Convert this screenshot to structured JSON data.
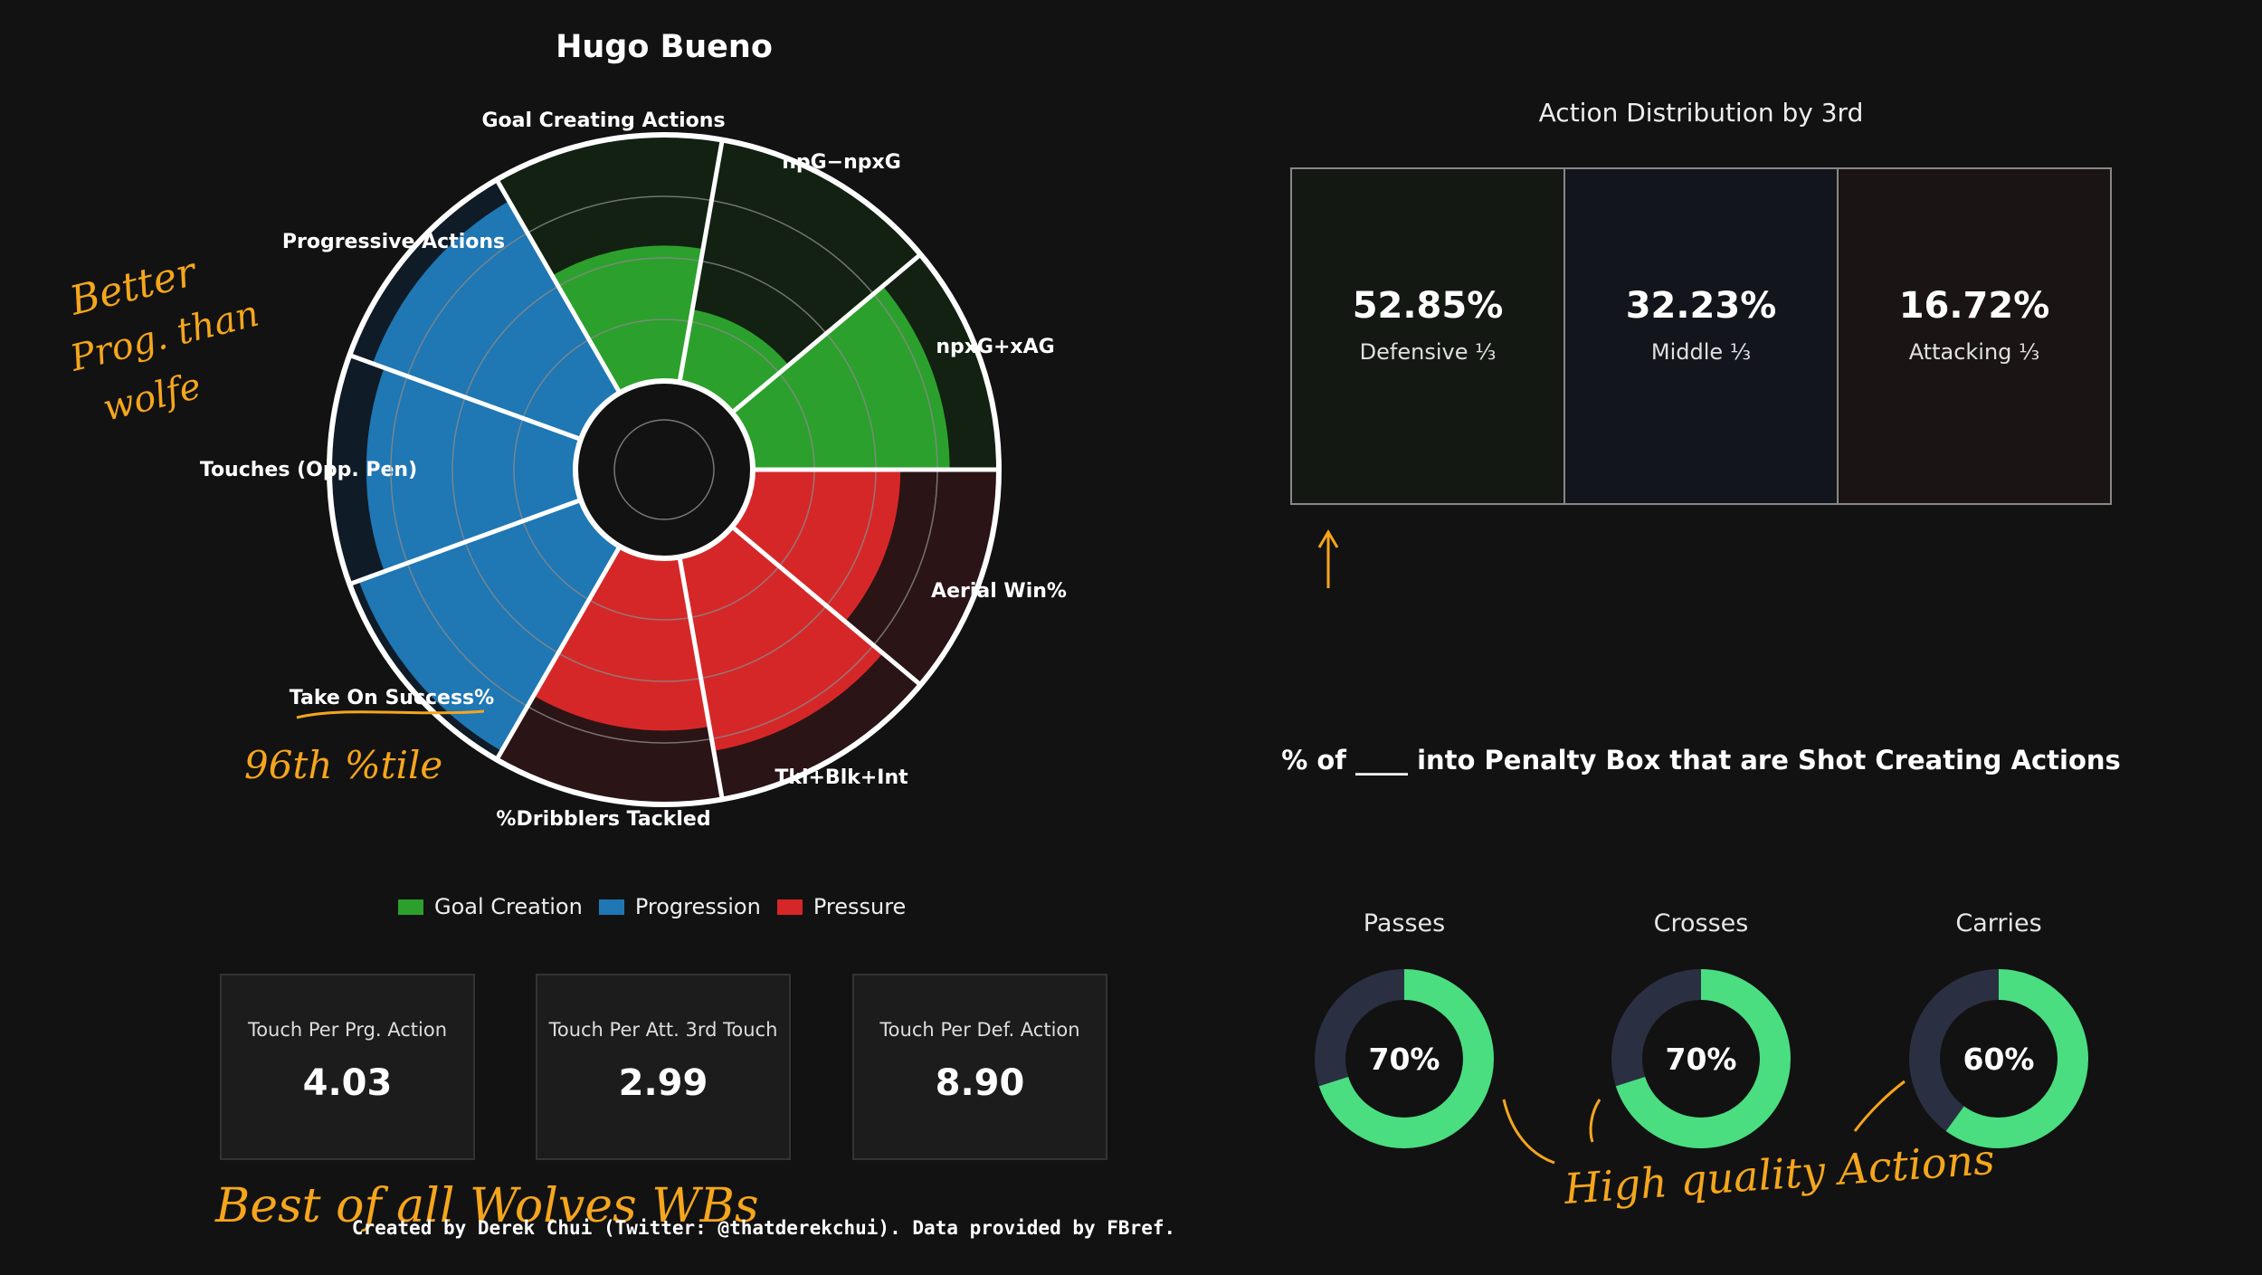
{
  "title": "Hugo Bueno",
  "colors": {
    "background": "#121212",
    "goal_creation": "#2ca02c",
    "progression": "#1f77b4",
    "pressure": "#d62728",
    "annotation": "#f5a61c",
    "donut_fill": "#4ade80",
    "donut_track": "#2a3042"
  },
  "legend": [
    {
      "label": "Goal Creation",
      "color": "#2ca02c"
    },
    {
      "label": "Progression",
      "color": "#1f77b4"
    },
    {
      "label": "Pressure",
      "color": "#d62728"
    }
  ],
  "stats": [
    {
      "label": "Touch Per Prg. Action",
      "value": "4.03"
    },
    {
      "label": "Touch Per Att. 3rd Touch",
      "value": "2.99"
    },
    {
      "label": "Touch Per Def. Action",
      "value": "8.90"
    }
  ],
  "distribution": {
    "title": "Action Distribution by 3rd",
    "zones": [
      {
        "pct": "52.85%",
        "label": "Defensive ⅓",
        "bg": "#131812"
      },
      {
        "pct": "32.23%",
        "label": "Middle ⅓",
        "bg": "#12151c"
      },
      {
        "pct": "16.72%",
        "label": "Attacking ⅓",
        "bg": "#1b1414"
      }
    ]
  },
  "sca": {
    "title": "% of ____ into Penalty Box that are Shot Creating Actions"
  },
  "annotations": {
    "prog_note": [
      "Better",
      "Prog. than",
      "wolfe"
    ],
    "take_on_note": "96th %tile",
    "wbs_note": "Best of all Wolves WBs",
    "quality_note": "High quality Actions"
  },
  "footer": "Created by Derek Chui (Twitter: @thatderekchui). Data provided by FBref.",
  "chart_data": [
    {
      "type": "radar",
      "subtype": "polar-bar (pizza)",
      "title": "Hugo Bueno",
      "scale": [
        0,
        100
      ],
      "categories": [
        "npxG+xAG",
        "npG−npxG",
        "Goal Creating Actions",
        "Progressive Actions",
        "Touches (Opp. Pen)",
        "Take On Success%",
        "%Dribblers Tackled",
        "Tkl+Blk+Int",
        "Aerial Win%"
      ],
      "groups": [
        "Goal Creation",
        "Goal Creation",
        "Goal Creation",
        "Progression",
        "Progression",
        "Progression",
        "Pressure",
        "Pressure",
        "Pressure"
      ],
      "values": [
        80,
        30,
        55,
        90,
        85,
        96,
        70,
        80,
        60
      ]
    },
    {
      "type": "pie",
      "subtype": "donut",
      "series": [
        {
          "name": "Passes",
          "value": 70,
          "label": "70%"
        },
        {
          "name": "Crosses",
          "value": 70,
          "label": "70%"
        },
        {
          "name": "Carries",
          "value": 60,
          "label": "60%"
        }
      ]
    }
  ]
}
